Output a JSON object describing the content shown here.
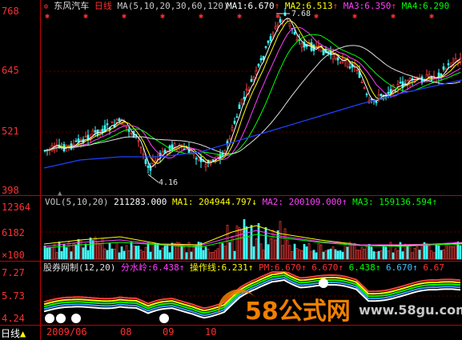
{
  "price_panel": {
    "icon": "star-gear-icon",
    "stock_name": "东风汽车",
    "period": "日线",
    "ma_params": "MA(5,10,20,30,60,120)",
    "ma1_label": "MA1:",
    "ma1_value": "6.670",
    "ma1_arrow": "↑",
    "ma2_label": "MA2:",
    "ma2_value": "6.513",
    "ma2_arrow": "↑",
    "ma3_label": "MA3:",
    "ma3_value": "6.350",
    "ma3_arrow": "↑",
    "ma4_label": "MA4:",
    "ma4_value": "6.290",
    "y_ticks": [
      "768",
      "645",
      "521",
      "398"
    ],
    "high_marker": "7.68",
    "low_marker": "4.16"
  },
  "volume_panel": {
    "label": "VOL(5,10,20)",
    "vol_value": "211283.000",
    "ma1": "MA1: 204944.797↓",
    "ma2": "MA2: 200109.000↑",
    "ma3": "MA3: 159136.594↑",
    "y_ticks": [
      "12364",
      "6182"
    ],
    "unit": "×100"
  },
  "indicator_panel": {
    "name": "股券网制(12,20)",
    "water_label": "分水岭:",
    "water_value": "6.438↑",
    "op_label": "操作线:",
    "op_value": "6.231↑",
    "pm_label": "PM:",
    "pm_value": "6.670↑",
    "v4": "6.670↑",
    "v5": "6.438↑",
    "v6": "6.670↑",
    "v7": "6.67",
    "y_ticks": [
      "7.27",
      "5.73",
      "4.24"
    ]
  },
  "footer": {
    "period": "日线",
    "dates": [
      "2009/06",
      "08",
      "09",
      "10"
    ]
  },
  "watermark": {
    "text": "58公式网",
    "url": "www.58gu.com"
  },
  "colors": {
    "price_axis": "#ff3030",
    "ma_white": "#ffffff",
    "ma_yellow": "#ffff00",
    "ma_magenta": "#ff40ff",
    "ma_green": "#00ff00",
    "ma_blue": "#2040ff",
    "up": "#ff4040",
    "down": "#40ffff",
    "watermark_orange": "#f08000"
  }
}
